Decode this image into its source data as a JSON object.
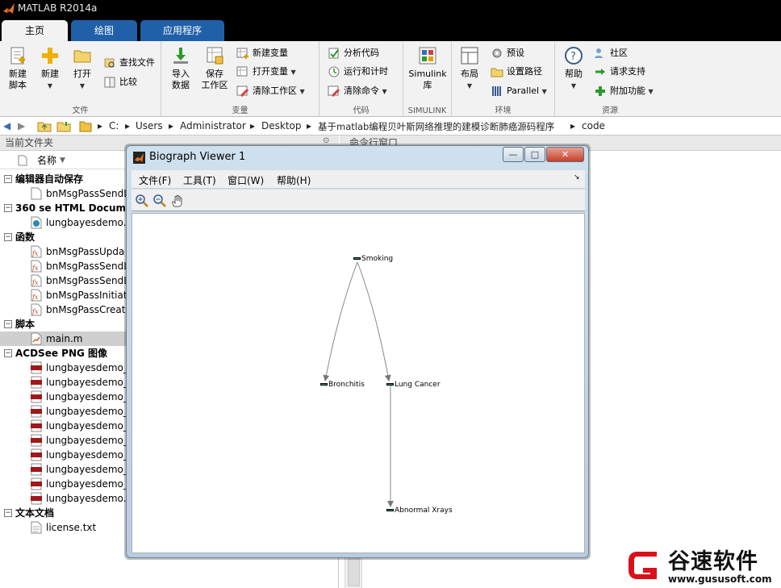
{
  "window": {
    "title": "MATLAB R2014a"
  },
  "tabs": [
    {
      "label": "主页"
    },
    {
      "label": "绘图"
    },
    {
      "label": "应用程序"
    }
  ],
  "ribbon": {
    "file": {
      "group_label": "文件",
      "new_script": "新建\n脚本",
      "new_script_l1": "新建",
      "new_script_l2": "脚本",
      "new": "新建",
      "open": "打开",
      "find_files": "查找文件",
      "compare": "比较"
    },
    "variable": {
      "group_label": "变量",
      "import_l1": "导入",
      "import_l2": "数据",
      "save_l1": "保存",
      "save_l2": "工作区",
      "new_variable": "新建变量",
      "open_variable": "打开变量",
      "clear_workspace": "清除工作区"
    },
    "code": {
      "group_label": "代码",
      "analyze": "分析代码",
      "run_time": "运行和计时",
      "clear_commands": "清除命令"
    },
    "simulink": {
      "group_label": "SIMULINK",
      "lib_l1": "Simulink",
      "lib_l2": "库"
    },
    "environment": {
      "group_label": "环境",
      "layout": "布局",
      "preferences": "预设",
      "set_path": "设置路径",
      "parallel": "Parallel"
    },
    "resources": {
      "group_label": "资源",
      "help": "帮助",
      "community": "社区",
      "request_support": "请求支持",
      "addons": "附加功能"
    }
  },
  "path": [
    "C:",
    "Users",
    "Administrator",
    "Desktop",
    "基于matlab编程贝叶斯网络推理的建模诊断肺癌源码程序",
    "code"
  ],
  "current_folder": {
    "title": "当前文件夹",
    "column_name": "名称",
    "sections": [
      {
        "label": "编辑器自动保存",
        "files": [
          "bnMsgPassSendL"
        ]
      },
      {
        "label": "360 se HTML Document",
        "files": [
          "lungbayesdemo.h"
        ]
      },
      {
        "label": "函数",
        "files": [
          "bnMsgPassUpda",
          "bnMsgPassSendL",
          "bnMsgPassSendL",
          "bnMsgPassInitiate",
          "bnMsgPassCreat"
        ]
      },
      {
        "label": "脚本",
        "files": [
          "main.m"
        ]
      },
      {
        "label": "ACDSee PNG 图像",
        "files": [
          "lungbayesdemo_",
          "lungbayesdemo_",
          "lungbayesdemo_",
          "lungbayesdemo_",
          "lungbayesdemo_",
          "lungbayesdemo_",
          "lungbayesdemo_",
          "lungbayesdemo_",
          "lungbayesdemo_",
          "lungbayesdemo."
        ]
      },
      {
        "label": "文本文档",
        "files": [
          "license.txt"
        ]
      }
    ]
  },
  "command_window": {
    "title": "命令行窗口"
  },
  "biograph": {
    "title": "Biograph Viewer 1",
    "menu": [
      "文件(F)",
      "工具(T)",
      "窗口(W)",
      "帮助(H)"
    ],
    "nodes": {
      "smoking": "Smoking",
      "bronchitis": "Bronchitis",
      "lung_cancer": "Lung Cancer",
      "abnormal_xrays": "Abnormal Xrays"
    },
    "edges": [
      [
        "Smoking",
        "Bronchitis"
      ],
      [
        "Smoking",
        "Lung Cancer"
      ],
      [
        "Lung Cancer",
        "Abnormal Xrays"
      ]
    ]
  },
  "watermark": {
    "brand": "谷速软件",
    "url": "www.gususoft.com"
  }
}
